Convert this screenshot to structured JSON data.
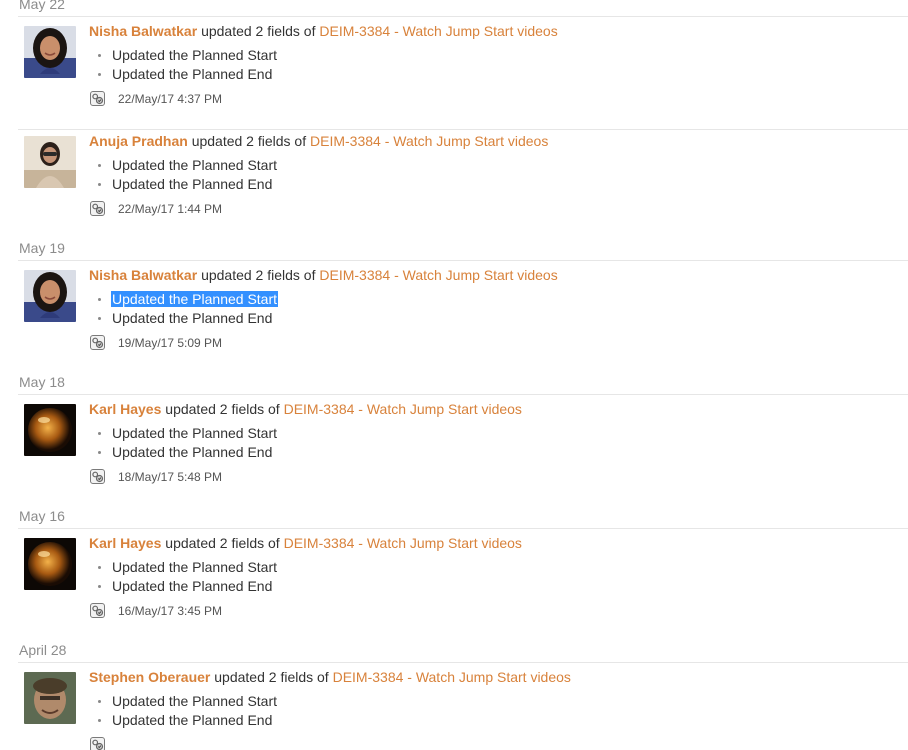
{
  "groups": [
    {
      "date": "May 22",
      "entries": [
        {
          "user": "Nisha Balwatkar",
          "action": "updated 2 fields of",
          "issue": "DEIM-3384 - Watch Jump Start videos",
          "fields": [
            "Updated the Planned Start",
            "Updated the Planned End"
          ],
          "time": "22/May/17 4:37 PM",
          "avatar": "nisha"
        },
        {
          "user": "Anuja Pradhan",
          "action": "updated 2 fields of",
          "issue": "DEIM-3384 - Watch Jump Start videos",
          "fields": [
            "Updated the Planned Start",
            "Updated the Planned End"
          ],
          "time": "22/May/17 1:44 PM",
          "avatar": "anuja"
        }
      ]
    },
    {
      "date": "May 19",
      "entries": [
        {
          "user": "Nisha Balwatkar",
          "action": "updated 2 fields of",
          "issue": "DEIM-3384 - Watch Jump Start videos",
          "fields": [
            "Updated the Planned Start",
            "Updated the Planned End"
          ],
          "selected_field": 0,
          "time": "19/May/17 5:09 PM",
          "avatar": "nisha"
        }
      ]
    },
    {
      "date": "May 18",
      "entries": [
        {
          "user": "Karl Hayes",
          "action": "updated 2 fields of",
          "issue": "DEIM-3384 - Watch Jump Start videos",
          "fields": [
            "Updated the Planned Start",
            "Updated the Planned End"
          ],
          "time": "18/May/17 5:48 PM",
          "avatar": "karl"
        }
      ]
    },
    {
      "date": "May 16",
      "entries": [
        {
          "user": "Karl Hayes",
          "action": "updated 2 fields of",
          "issue": "DEIM-3384 - Watch Jump Start videos",
          "fields": [
            "Updated the Planned Start",
            "Updated the Planned End"
          ],
          "time": "16/May/17 3:45 PM",
          "avatar": "karl"
        }
      ]
    },
    {
      "date": "April 28",
      "entries": [
        {
          "user": "Stephen Oberauer",
          "action": "updated 2 fields of",
          "issue": "DEIM-3384 - Watch Jump Start videos",
          "fields": [
            "Updated the Planned Start",
            "Updated the Planned End"
          ],
          "time": "",
          "avatar": "stephen"
        }
      ]
    }
  ],
  "colors": {
    "link": "#d8823b",
    "text": "#333333",
    "date_header": "#8c8c8c",
    "divider": "#e6e6e6",
    "selection": "#3390ff"
  },
  "icons": {
    "meta": "jira-service-icon"
  }
}
